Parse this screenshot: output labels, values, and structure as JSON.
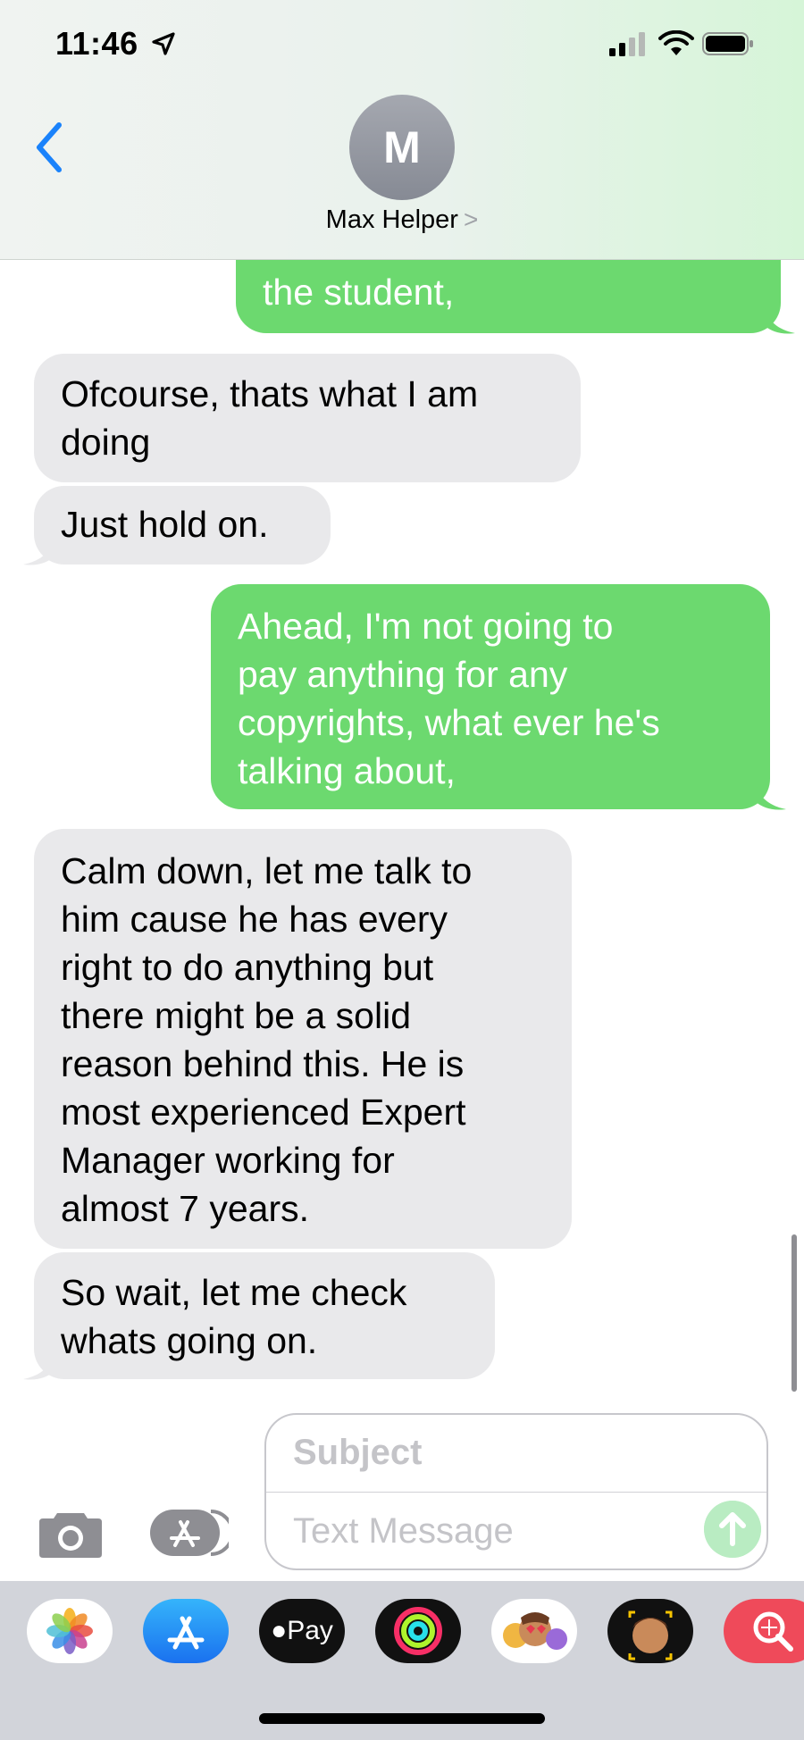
{
  "status_bar": {
    "time": "11:46"
  },
  "header": {
    "avatar_initial": "M",
    "contact_name": "Max Helper",
    "chevron": ">"
  },
  "messages": [
    {
      "direction": "outgoing",
      "text": "the student,"
    },
    {
      "direction": "incoming",
      "lines": [
        "Ofcourse, thats what I am",
        "doing"
      ]
    },
    {
      "direction": "incoming",
      "text": "Just hold on."
    },
    {
      "direction": "outgoing",
      "lines": [
        "Ahead, I'm not going to",
        "pay anything for any",
        "copyrights, what ever he's",
        "talking about,"
      ]
    },
    {
      "direction": "incoming",
      "lines": [
        "Calm down, let me talk to",
        "him cause he has every",
        "right to do anything but",
        "there might be a solid",
        "reason behind this. He is",
        "most experienced Expert",
        "Manager working for",
        "almost 7 years."
      ]
    },
    {
      "direction": "incoming",
      "lines": [
        "So wait, let me check",
        "whats going on."
      ]
    }
  ],
  "compose": {
    "subject_placeholder": "Subject",
    "text_placeholder": "Text Message"
  },
  "app_drawer": {
    "apps": [
      {
        "name": "Photos",
        "icon": "photos-icon"
      },
      {
        "name": "App Store",
        "icon": "appstore-icon"
      },
      {
        "name": "Pay",
        "icon": "applepay-icon",
        "label": "Pay"
      },
      {
        "name": "Activity",
        "icon": "activity-icon"
      },
      {
        "name": "Memoji Stickers",
        "icon": "memoji-stickers-icon"
      },
      {
        "name": "Memoji",
        "icon": "memoji-icon"
      },
      {
        "name": "Search",
        "icon": "image-search-icon"
      }
    ]
  },
  "colors": {
    "outgoing": "#6cd96f",
    "incoming": "#e9e9eb",
    "accent": "#1a82fb"
  }
}
